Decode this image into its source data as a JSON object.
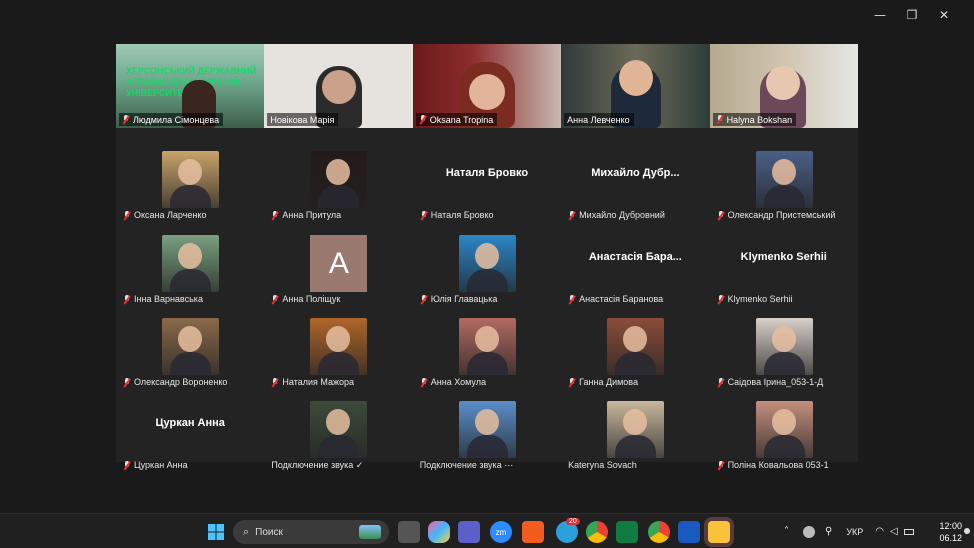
{
  "window": {
    "minimize_glyph": "—",
    "restore_glyph": "❐",
    "close_glyph": "✕"
  },
  "video_row": [
    {
      "name": "Людмила Сімонцева",
      "muted": true
    },
    {
      "name": "Новікова Марія",
      "muted": false
    },
    {
      "name": "Oksana Tropina",
      "muted": true,
      "active": true
    },
    {
      "name": "Анна Левченко",
      "muted": false
    },
    {
      "name": "Halyna Bokshan",
      "muted": true
    }
  ],
  "participants": [
    [
      {
        "name": "Оксана Ларченко",
        "type": "photo",
        "color": "#c9a36b"
      },
      {
        "name": "Анна Притула",
        "type": "photo",
        "color": "#241a1a"
      },
      {
        "name": "Наталя Бровко",
        "type": "text",
        "big": "Наталя Бровко"
      },
      {
        "name": "Михайло Дубровний",
        "type": "text",
        "big": "Михайло Дубр..."
      },
      {
        "name": "Олександр Пристемський",
        "type": "photo",
        "color": "#4a5f86"
      }
    ],
    [
      {
        "name": "Інна Варнавська",
        "type": "photo",
        "color": "#7aa07f"
      },
      {
        "name": "Анна Поліщук",
        "type": "letter",
        "letter": "A"
      },
      {
        "name": "Юлія Главацька",
        "type": "photo",
        "color": "#2b86c8"
      },
      {
        "name": "Анастасія Баранова",
        "type": "text",
        "big": "Анастасія Бара..."
      },
      {
        "name": "Klymenko Serhii",
        "type": "text",
        "big": "Klymenko Serhii"
      }
    ],
    [
      {
        "name": "Олександр Вороненко",
        "type": "photo",
        "color": "#8a6a4a"
      },
      {
        "name": "Наталия Мажора",
        "type": "photo",
        "color": "#b0662a"
      },
      {
        "name": "Анна Хомула",
        "type": "photo",
        "color": "#b26a62"
      },
      {
        "name": "Ганна Димова",
        "type": "photo",
        "color": "#8b4d3a"
      },
      {
        "name": "Саідова Ірина_053-1-Д",
        "type": "photo",
        "color": "#d8cfc9"
      }
    ],
    [
      {
        "name": "Цуркан Анна",
        "type": "text",
        "big": "Цуркан Анна"
      },
      {
        "name": "Подключение звука ✓",
        "type": "photo",
        "color": "#3d4b3a",
        "nomic": true
      },
      {
        "name": "Подключение звука ⋯",
        "type": "photo",
        "color": "#5a8fc9",
        "nomic": true
      },
      {
        "name": "Kateryna Sovach",
        "type": "photo",
        "color": "#c9b79e",
        "nomic": true
      },
      {
        "name": "Поліна Ковальова 053-1",
        "type": "photo",
        "color": "#c48f7d"
      }
    ]
  ],
  "taskbar": {
    "search_placeholder": "Поиск",
    "language": "УКР",
    "time": "12:00",
    "date": "06.12",
    "badge_count": "20"
  }
}
